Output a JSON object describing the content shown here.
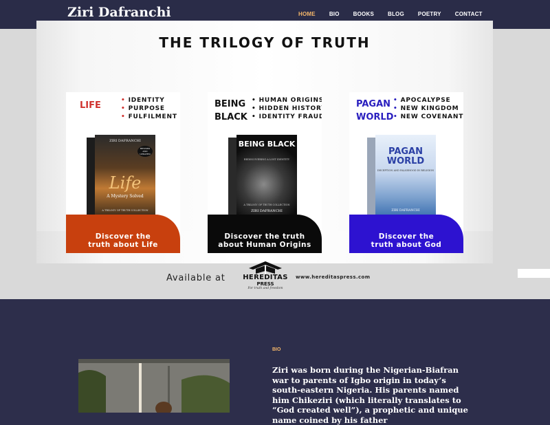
{
  "header": {
    "site_title": "Ziri Dafranchi",
    "nav": [
      {
        "label": "HOME",
        "active": true
      },
      {
        "label": "BIO",
        "active": false
      },
      {
        "label": "BOOKS",
        "active": false
      },
      {
        "label": "BLOG",
        "active": false
      },
      {
        "label": "POETRY",
        "active": false
      },
      {
        "label": "CONTACT",
        "active": false
      }
    ]
  },
  "banner": {
    "title": "THE TRILOGY OF TRUTH",
    "books": [
      {
        "label_lines": [
          "LIFE"
        ],
        "label_color": "#d0312d",
        "bullets": [
          "IDENTITY",
          "PURPOSE",
          "FULFILMENT"
        ],
        "cover_author": "ZIRI DAFRANCHI",
        "cover_title": "Life",
        "cover_subtitle": "A Mystery Solved",
        "cover_badge": "REVISED AND UPDATED",
        "cover_series": "A TRILOGY OF TRUTH COLLECTION",
        "footer_line1": "Discover the",
        "footer_line2": "truth about Life",
        "footer_color": "#c8400e"
      },
      {
        "label_lines": [
          "BEING",
          "BLACK"
        ],
        "label_color": "#111111",
        "bullets": [
          "HUMAN ORIGINS",
          "HIDDEN HISTORY",
          "IDENTITY FRAUD"
        ],
        "cover_title": "BEING BLACK",
        "cover_subtitle": "REDISCOVERING A LOST IDENTITY",
        "cover_series": "A TRILOGY OF TRUTH COLLECTION",
        "cover_author": "ZIRI DAFRANCHI",
        "footer_line1": "Discover the truth",
        "footer_line2": "about Human Origins",
        "footer_color": "#0a0a0a"
      },
      {
        "label_lines": [
          "PAGAN",
          "WORLD"
        ],
        "label_color": "#2a1fbf",
        "bullets": [
          "APOCALYPSE",
          "NEW KINGDOM",
          "NEW COVENANT"
        ],
        "cover_title": "PAGAN WORLD",
        "cover_subtitle": "DECEPTION AND FALSEHOOD IN RELIGION",
        "cover_author": "ZIRI DAFRANCHI",
        "footer_line1": "Discover the",
        "footer_line2": "truth about God",
        "footer_color": "#2d12d0"
      }
    ],
    "available_text": "Available at",
    "publisher_name": "HEREDITAS",
    "publisher_sub": "PRESS",
    "publisher_tagline": "For truth and freedom",
    "publisher_url": "www.hereditaspress.com"
  },
  "bio": {
    "label": "BIO",
    "text": "Ziri was born during the Nigerian-Biafran war to parents of Igbo origin in today’s south-eastern Nigeria. His parents named him Chikeziri (which literally translates to “God created well”), a prophetic and unique name coined by his father"
  }
}
